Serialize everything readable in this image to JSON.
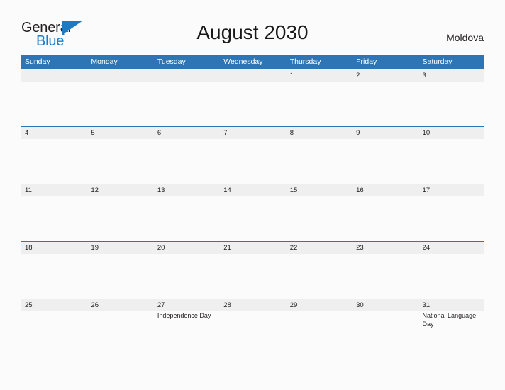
{
  "logo": {
    "text_top": "General",
    "text_bottom": "Blue",
    "flag_icon": "blue-triangle-flag-icon",
    "color_dark": "#231f20",
    "color_blue": "#1f7ac4"
  },
  "header": {
    "title": "August 2030",
    "country": "Moldova"
  },
  "theme": {
    "header_blue": "#2e75b6",
    "row_band_gray": "#efefef",
    "page_background": "#fbfbfc",
    "text_color": "#231f20"
  },
  "calendar": {
    "month": "August",
    "year": "2030",
    "weekdays": [
      "Sunday",
      "Monday",
      "Tuesday",
      "Wednesday",
      "Thursday",
      "Friday",
      "Saturday"
    ],
    "weeks": [
      [
        {
          "day": ""
        },
        {
          "day": ""
        },
        {
          "day": ""
        },
        {
          "day": ""
        },
        {
          "day": "1"
        },
        {
          "day": "2"
        },
        {
          "day": "3"
        }
      ],
      [
        {
          "day": "4"
        },
        {
          "day": "5"
        },
        {
          "day": "6"
        },
        {
          "day": "7"
        },
        {
          "day": "8"
        },
        {
          "day": "9"
        },
        {
          "day": "10"
        }
      ],
      [
        {
          "day": "11"
        },
        {
          "day": "12"
        },
        {
          "day": "13"
        },
        {
          "day": "14"
        },
        {
          "day": "15"
        },
        {
          "day": "16"
        },
        {
          "day": "17"
        }
      ],
      [
        {
          "day": "18"
        },
        {
          "day": "19"
        },
        {
          "day": "20"
        },
        {
          "day": "21"
        },
        {
          "day": "22"
        },
        {
          "day": "23"
        },
        {
          "day": "24"
        }
      ],
      [
        {
          "day": "25"
        },
        {
          "day": "26"
        },
        {
          "day": "27",
          "event": "Independence Day"
        },
        {
          "day": "28"
        },
        {
          "day": "29"
        },
        {
          "day": "30"
        },
        {
          "day": "31",
          "event": "National Language Day"
        }
      ]
    ]
  }
}
